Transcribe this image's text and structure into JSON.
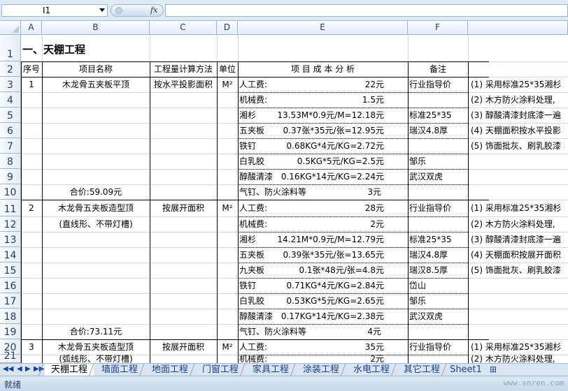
{
  "formula_bar": {
    "name_box": "I1",
    "fx_label": "fx",
    "formula": ""
  },
  "columns": [
    "A",
    "B",
    "C",
    "D",
    "E",
    "F"
  ],
  "rows": [
    "1",
    "2",
    "3",
    "4",
    "5",
    "6",
    "7",
    "8",
    "9",
    "10",
    "11",
    "12",
    "13",
    "14",
    "15",
    "16",
    "17",
    "18",
    "19",
    "20",
    "21"
  ],
  "title": "一、天棚工程",
  "header": {
    "seq": "序号",
    "name": "项目名称",
    "method": "工程量计算方法",
    "unit": "单位",
    "analysis": "项 目 成 本 分 析",
    "note": "备注"
  },
  "items": [
    {
      "seq": "1",
      "name_lines": [
        "木龙骨五夹板平顶"
      ],
      "method": "按水平投影面积",
      "unit": "M²",
      "total": "合价:59.09元",
      "costs": [
        {
          "label": "人工费:",
          "calc": "",
          "amount": "22元"
        },
        {
          "label": "机械费:",
          "calc": "",
          "amount": "1.5元"
        },
        {
          "label": "湘杉",
          "calc": "13.53M*0.9元/M=12.18元",
          "amount": ""
        },
        {
          "label": "五夹板",
          "calc": "0.37张*35元/张=12.95元",
          "amount": ""
        },
        {
          "label": "铁钉",
          "calc": "0.68KG*4元/KG=2.72元",
          "amount": ""
        },
        {
          "label": "白乳胶",
          "calc": "0.5KG*5元/KG=2.5元",
          "amount": ""
        },
        {
          "label": "醇酸清漆",
          "calc": "0.16KG*14元/KG=2.24元",
          "amount": ""
        },
        {
          "label": "气钉、防火涂料等",
          "calc": "",
          "amount": "3元"
        }
      ],
      "notes": [
        "行业指导价",
        "",
        "标准25*35",
        "瑞汉4.8厚",
        "",
        "邹乐",
        "武汉双虎",
        ""
      ],
      "remarks": [
        "(1) 采用标准25*35湘杉",
        "(2) 木方防火涂料处理,",
        "(3) 醇酸清漆封底漆一遍",
        "(4) 天棚面积按水平投影",
        "(5) 饰面批灰、刷乳胶漆",
        "",
        "",
        ""
      ]
    },
    {
      "seq": "2",
      "name_lines": [
        "木龙骨五夹板造型顶",
        "(直线形、不带灯槽)"
      ],
      "method": "按展开面积",
      "unit": "M²",
      "total": "合价:73.11元",
      "costs": [
        {
          "label": "人工费:",
          "calc": "",
          "amount": "28元"
        },
        {
          "label": "机械费:",
          "calc": "",
          "amount": "2元"
        },
        {
          "label": "湘杉",
          "calc": "14.21M*0.9元/M=12.79元",
          "amount": ""
        },
        {
          "label": "五夹板",
          "calc": "0.39张*35元/张=13.65元",
          "amount": ""
        },
        {
          "label": "九夹板",
          "calc": "0.1张*48元/张=4.8元",
          "amount": ""
        },
        {
          "label": "铁钉",
          "calc": "0.71KG*4元/KG=2.84元",
          "amount": ""
        },
        {
          "label": "白乳胶",
          "calc": "0.53KG*5元/KG=2.65元",
          "amount": ""
        },
        {
          "label": "醇酸清漆",
          "calc": "0.17KG*14元/KG=2.38元",
          "amount": ""
        },
        {
          "label": "气钉、防火涂料等",
          "calc": "",
          "amount": "4元"
        }
      ],
      "notes": [
        "行业指导价",
        "",
        "标准25*35",
        "瑞汉4.8厚",
        "瑞汉8.5厚",
        "岱山",
        "邹乐",
        "武汉双虎",
        ""
      ],
      "remarks": [
        "(1) 采用标准25*35湘杉",
        "(2) 木方防火涂料处理,",
        "(3) 醇酸清漆封底漆一遍",
        "(4) 天棚面积按展开面积",
        "(5) 饰面批灰、刷乳胶漆",
        "",
        "",
        "",
        ""
      ]
    },
    {
      "seq": "3",
      "name_lines": [
        "木龙骨五夹板造型顶",
        "(弧线形、不带灯槽)"
      ],
      "method": "按展开面积",
      "unit": "M²",
      "costs": [
        {
          "label": "人工费:",
          "calc": "",
          "amount": "35元"
        },
        {
          "label": "机械费:",
          "calc": "",
          "amount": "2元"
        }
      ],
      "notes": [
        "行业指导价",
        ""
      ],
      "remarks": [
        "(1) 采用标准25*35湘杉",
        "(2) 木方防火涂料处理,"
      ]
    }
  ],
  "sheet_tabs": [
    "天棚工程",
    "墙面工程",
    "地面工程",
    "门窗工程",
    "家具工程",
    "涂装工程",
    "水电工程",
    "其它工程",
    "Sheet1"
  ],
  "active_tab": "天棚工程",
  "status": {
    "ready": "就绪",
    "watermark": "www.snren.com"
  }
}
